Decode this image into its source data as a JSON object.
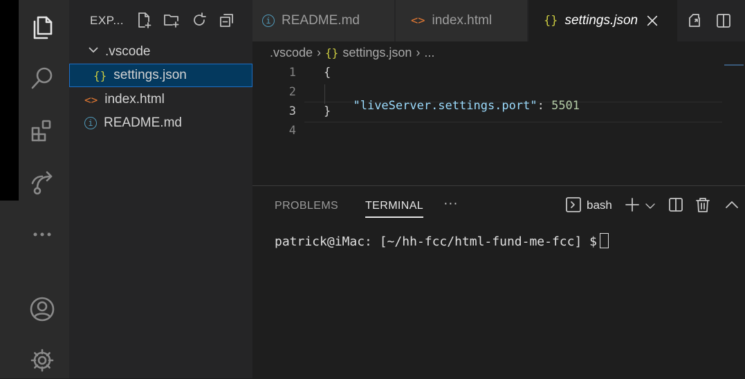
{
  "explorer": {
    "title": "EXP...",
    "tree": [
      {
        "label": ".vscode",
        "type": "folder",
        "expanded": true
      },
      {
        "label": "settings.json",
        "icon": "{}",
        "selected": true
      },
      {
        "label": "index.html",
        "icon": "<>"
      },
      {
        "label": "README.md",
        "icon": "i"
      }
    ]
  },
  "tabs": [
    {
      "label": "README.md",
      "icon": "i",
      "active": false
    },
    {
      "label": "index.html",
      "icon": "<>",
      "active": false
    },
    {
      "label": "settings.json",
      "icon": "{}",
      "active": true
    }
  ],
  "breadcrumb": {
    "folder": ".vscode",
    "file_icon": "{}",
    "file": "settings.json",
    "more": "..."
  },
  "editor": {
    "lines": [
      {
        "num": "1",
        "text": "{"
      },
      {
        "num": "2",
        "key": "\"liveServer.settings.port\"",
        "sep": ": ",
        "value": "5501"
      },
      {
        "num": "3",
        "text": "}"
      },
      {
        "num": "4",
        "text": ""
      }
    ]
  },
  "panel": {
    "tabs": [
      "PROBLEMS",
      "TERMINAL"
    ],
    "active_tab": "TERMINAL",
    "more": "···",
    "shell": "bash",
    "terminal_prompt": "patrick@iMac: [~/hh-fcc/html-fund-me-fcc] $"
  },
  "colors": {
    "json_key": "#9cdcfe",
    "json_number": "#b5cea8",
    "json_icon": "#cbcb41",
    "html_icon": "#e37933",
    "info_icon": "#519aba",
    "selection_bg": "#04395e"
  },
  "icons": [
    "files-icon",
    "search-icon",
    "extensions-icon",
    "remote-icon",
    "more-icon",
    "account-icon",
    "gear-icon",
    "new-file-icon",
    "new-folder-icon",
    "refresh-icon",
    "collapse-icon",
    "close-icon",
    "split-editor-icon",
    "open-changes-icon",
    "terminal-icon",
    "add-icon",
    "chevron-down-icon",
    "split-terminal-icon",
    "trash-icon",
    "chevron-up-icon"
  ]
}
